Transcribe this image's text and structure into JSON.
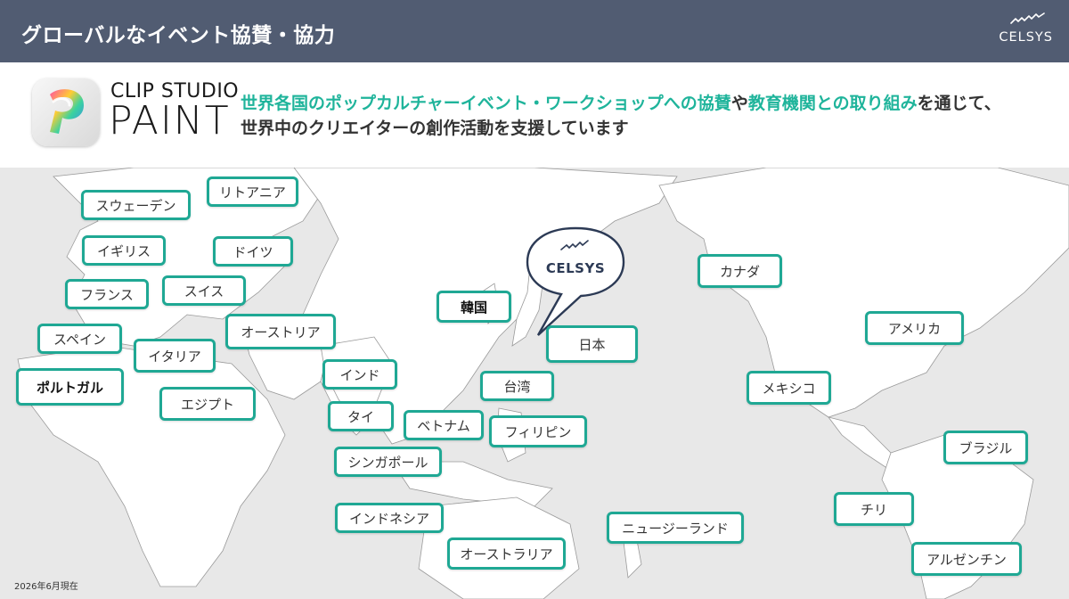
{
  "header": {
    "title": "グローバルなイベント協賛・協力",
    "brand": "CELSYS"
  },
  "app": {
    "name_top": "CLIP STUDIO",
    "name_main": "PAINT",
    "icon": "clip-studio-paint-icon"
  },
  "lead": {
    "part1": "世界各国のポップカルチャーイベント・ワークショップへの協賛",
    "part2": "や",
    "part3": "教育機関との取り組み",
    "part4": "を通じて、",
    "line2": "世界中のクリエイターの創作活動を支援しています"
  },
  "map": {
    "bubble_label": "CELSYS",
    "countries": [
      "スウェーデン",
      "リトアニア",
      "イギリス",
      "ドイツ",
      "フランス",
      "スイス",
      "スペイン",
      "オーストリア",
      "イタリア",
      "ポルトガル",
      "エジプト",
      "インド",
      "タイ",
      "ベトナム",
      "シンガポール",
      "インドネシア",
      "韓国",
      "日本",
      "台湾",
      "フィリピン",
      "オーストラリア",
      "ニュージーランド",
      "カナダ",
      "アメリカ",
      "メキシコ",
      "ブラジル",
      "チリ",
      "アルゼンチン"
    ]
  },
  "footnote": "2026年6月現在",
  "colors": {
    "header_bg": "#515c72",
    "accent": "#1fb49b",
    "tag_border": "#1fa894",
    "map_bg": "#e8e8e8",
    "land": "#ffffff"
  }
}
